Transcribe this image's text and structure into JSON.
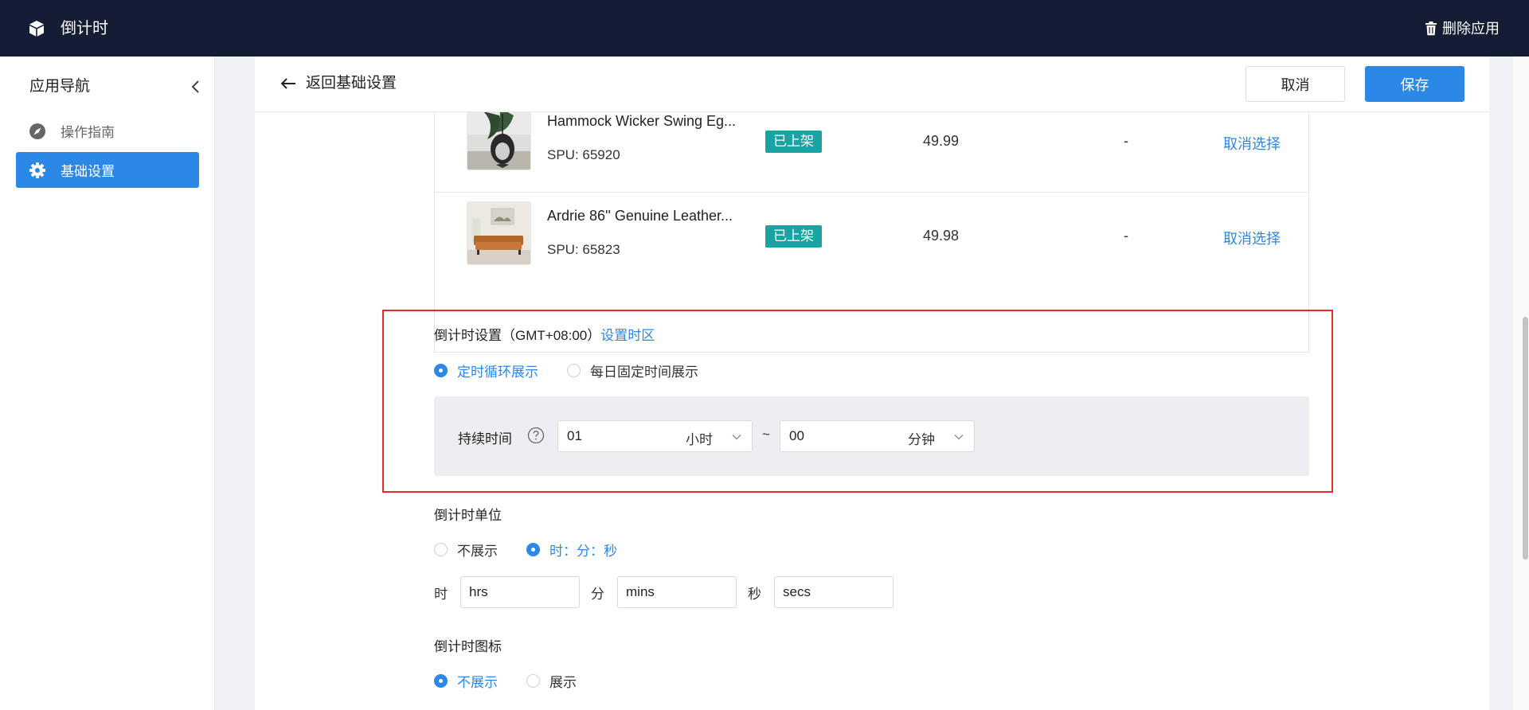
{
  "app": {
    "title": "倒计时",
    "delete_label": "删除应用",
    "logo_icon": "cube-icon"
  },
  "sidebar": {
    "title": "应用导航",
    "items": [
      {
        "label": "操作指南",
        "icon": "compass-icon",
        "active": false
      },
      {
        "label": "基础设置",
        "icon": "gear-icon",
        "active": true
      }
    ]
  },
  "header": {
    "back_label": "返回基础设置",
    "cancel_label": "取消",
    "save_label": "保存"
  },
  "products": [
    {
      "name": "Hammock Wicker Swing Eg...",
      "spu": "SPU: 65920",
      "status": "已上架",
      "price": "49.99",
      "extra": "-",
      "action": "取消选择"
    },
    {
      "name": "Ardrie 86'' Genuine Leather...",
      "spu": "SPU: 65823",
      "status": "已上架",
      "price": "49.98",
      "extra": "-",
      "action": "取消选择"
    }
  ],
  "countdown_settings": {
    "title": "倒计时设置（GMT+08:00）",
    "timezone_link": "设置时区",
    "mode_options": [
      "定时循环展示",
      "每日固定时间展示"
    ],
    "mode_selected": "定时循环展示",
    "duration": {
      "label": "持续时间",
      "hours_value": "01",
      "hours_unit": "小时",
      "separator": "~",
      "minutes_value": "00",
      "minutes_unit": "分钟"
    }
  },
  "countdown_unit": {
    "title": "倒计时单位",
    "options": [
      "不展示",
      "时：分：秒"
    ],
    "selected": "时：分：秒",
    "fields": [
      {
        "label": "时",
        "value": "hrs"
      },
      {
        "label": "分",
        "value": "mins"
      },
      {
        "label": "秒",
        "value": "secs"
      }
    ]
  },
  "countdown_icon": {
    "title": "倒计时图标",
    "options": [
      "不展示",
      "展示"
    ],
    "selected": "不展示"
  },
  "colors": {
    "topbar": "#141d33",
    "accent": "#2b88e6",
    "status_badge": "#1aa3a3",
    "highlight_border": "#e82c2c"
  }
}
